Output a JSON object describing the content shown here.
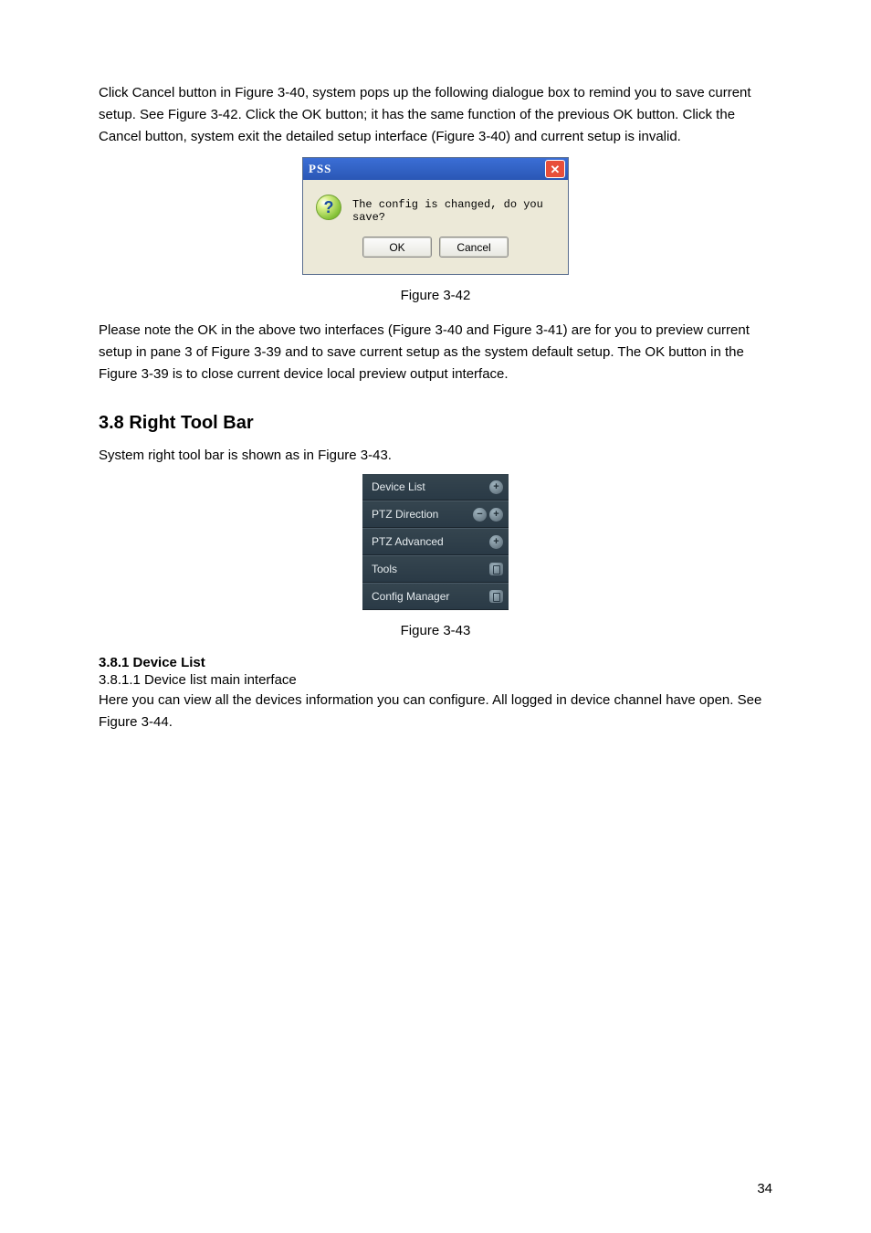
{
  "paragraphs": {
    "p1": "Click Cancel button in Figure 3-40, system pops up the following dialogue box to remind you to save current setup. See Figure 3-42. Click the OK button; it has the same function of the previous OK button. Click the Cancel button, system exit the detailed setup interface (Figure 3-40) and current setup is invalid.",
    "p2": "Please note the OK in the above two interfaces (Figure 3-40 and Figure 3-41) are for you to preview current setup in pane 3 of Figure 3-39 and to save current setup as the system default setup. The OK button in the Figure 3-39 is to close current device local preview output interface.",
    "p3": "System right tool bar is shown as in Figure 3-43.",
    "p4": "Here you can view all the devices information you can configure. All logged in device channel have open. See Figure 3-44."
  },
  "captions": {
    "fig42": "Figure 3-42",
    "fig43": "Figure 3-43"
  },
  "headings": {
    "sec38": "3.8  Right Tool Bar",
    "sub381": "3.8.1  Device List",
    "sub3811": "3.8.1.1  Device list main interface"
  },
  "dialog": {
    "title": "PSS",
    "close_glyph": "✕",
    "icon_glyph": "?",
    "message": "The config is changed, do you save?",
    "ok_label": "OK",
    "cancel_label": "Cancel"
  },
  "right_tool_bar": {
    "rows": [
      {
        "label": "Device List",
        "icons": [
          "plus"
        ]
      },
      {
        "label": "PTZ Direction",
        "icons": [
          "minus",
          "plus"
        ]
      },
      {
        "label": "PTZ Advanced",
        "icons": [
          "plus"
        ]
      },
      {
        "label": "Tools",
        "icons": [
          "panel"
        ]
      },
      {
        "label": "Config Manager",
        "icons": [
          "panel"
        ]
      }
    ]
  },
  "page_number": "34"
}
